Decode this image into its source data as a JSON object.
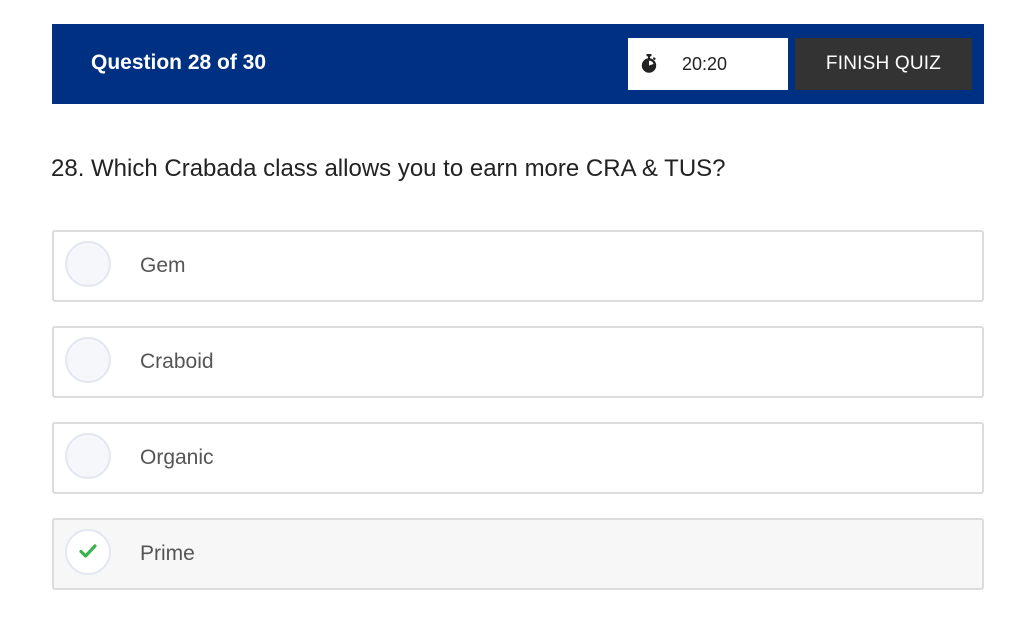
{
  "header": {
    "progress": "Question 28 of 30",
    "timer": {
      "icon": "stopwatch-icon",
      "time": "20:20"
    },
    "finish_label": "FINISH QUIZ"
  },
  "question": {
    "text": "28. Which Crabada class allows you to earn more CRA & TUS?"
  },
  "answers": [
    {
      "label": "Gem",
      "selected": false
    },
    {
      "label": "Craboid",
      "selected": false
    },
    {
      "label": "Organic",
      "selected": false
    },
    {
      "label": "Prime",
      "selected": true
    }
  ],
  "colors": {
    "header_bg": "#003082",
    "finish_bg": "#333333",
    "check": "#3cb34a"
  }
}
